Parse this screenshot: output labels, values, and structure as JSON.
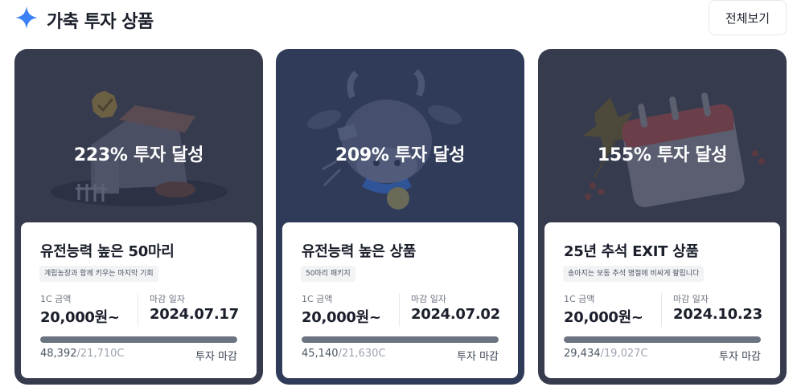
{
  "header": {
    "title": "가축 투자 상품",
    "view_all_label": "전체보기",
    "accent_color": "#3b82f6"
  },
  "labels": {
    "price": "1C 금액",
    "deadline": "마감 일자"
  },
  "cards": [
    {
      "achievement": "223% 투자 달성",
      "name": "유전능력 높은 50마리",
      "tag": "계립농장과 함께 키우는 마지막 기회",
      "price": "20,000원~",
      "deadline": "2024.07.17",
      "sold": "48,392",
      "separator": "/",
      "goal": "21,710C",
      "progress_percent": 100,
      "status": "투자 마감",
      "art": "house-with-badge"
    },
    {
      "achievement": "209% 투자 달성",
      "name": "유전능력 높은 상품",
      "tag": "50마리 패키지",
      "price": "20,000원~",
      "deadline": "2024.07.02",
      "sold": "45,140",
      "separator": "/",
      "goal": "21,630C",
      "progress_percent": 100,
      "status": "투자 마감",
      "art": "cow-with-medal"
    },
    {
      "achievement": "155% 투자 달성",
      "name": "25년 추석 EXIT 상품",
      "tag": "송아지는 보동 추석 명절에 비싸게 팔립니다",
      "price": "20,000원~",
      "deadline": "2024.10.23",
      "sold": "29,434",
      "separator": "/",
      "goal": "19,027C",
      "progress_percent": 100,
      "status": "투자 마감",
      "art": "calendar-with-leaves"
    }
  ]
}
